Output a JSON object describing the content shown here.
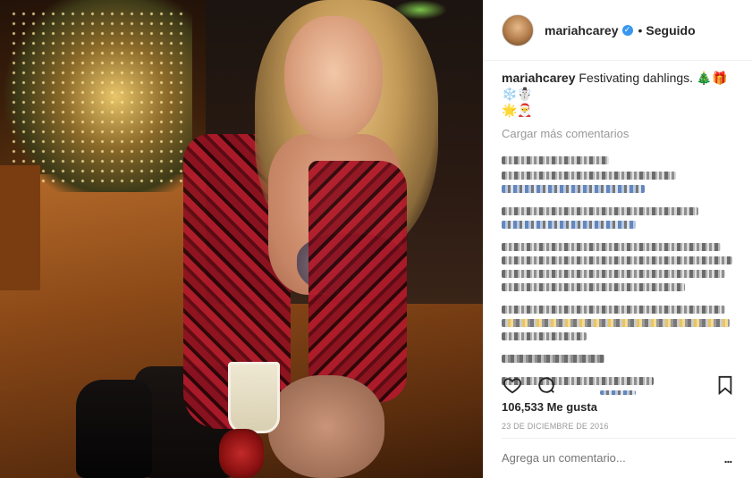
{
  "header": {
    "username": "mariahcarey",
    "verified_icon": "verified-badge-icon",
    "separator": "•",
    "follow_label": "Seguido"
  },
  "caption": {
    "username": "mariahcarey",
    "text": "Festivating dahlings. 🎄🎁❄️☃️",
    "text_line2": "🌟🎅"
  },
  "comments": {
    "load_more_label": "Cargar más comentarios"
  },
  "actions": {
    "like_icon": "heart-icon",
    "comment_icon": "comment-icon",
    "save_icon": "bookmark-icon"
  },
  "likes": {
    "count_label": "106,533 Me gusta"
  },
  "post": {
    "date": "23 DE DICIEMBRE DE 2016"
  },
  "add_comment": {
    "placeholder": "Agrega un comentario...",
    "more_label": "..."
  },
  "colors": {
    "verified": "#3897f0",
    "text_primary": "#262626",
    "text_secondary": "#999999",
    "border": "#efefef"
  }
}
